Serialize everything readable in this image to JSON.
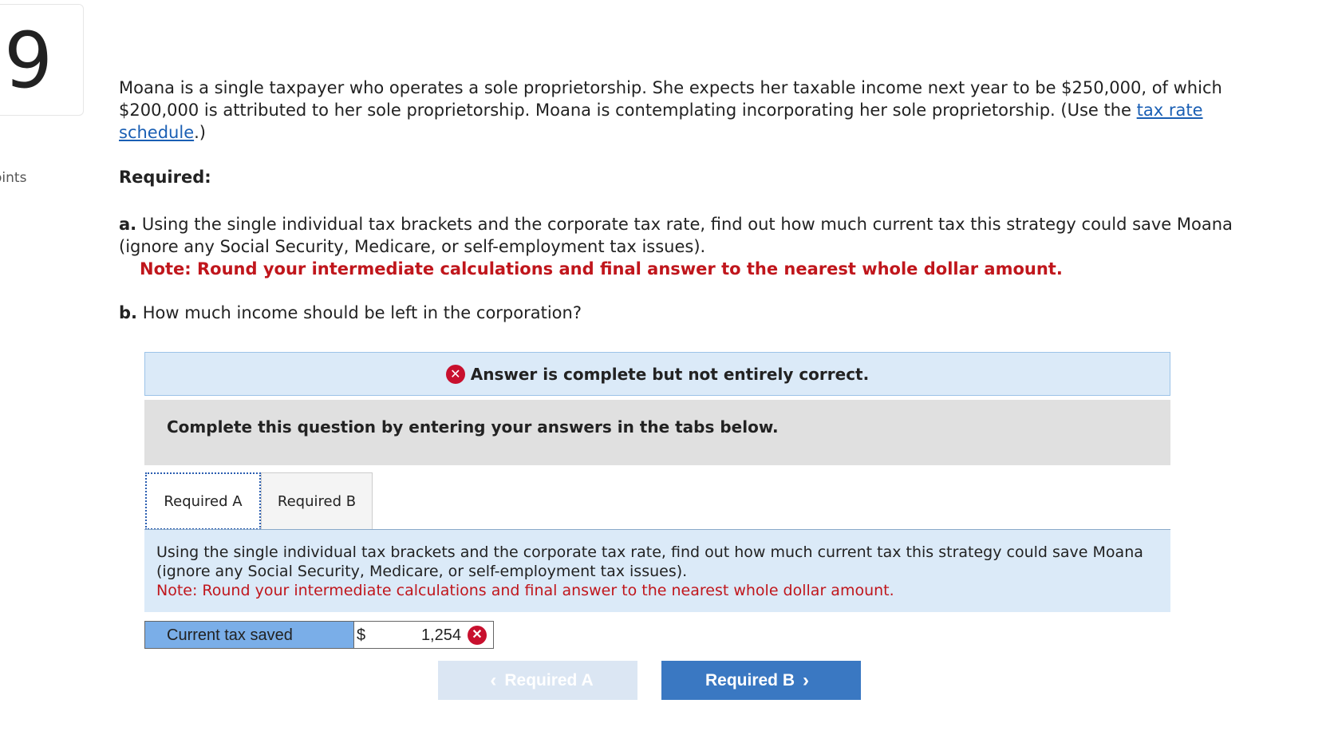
{
  "question": {
    "number": "9",
    "points_label": "oints",
    "intro_text": "Moana is a single taxpayer who operates a sole proprietorship. She expects her taxable income next year to be $250,000, of which $200,000 is attributed to her sole proprietorship. Moana is contemplating incorporating her sole proprietorship. (Use the ",
    "intro_link": "tax rate schedule",
    "intro_end": ".)",
    "required_heading": "Required:",
    "part_a_label": "a.",
    "part_a_text": "Using the single individual tax brackets and the corporate tax rate, find out how much current tax this strategy could save Moana (ignore any Social Security, Medicare, or self-employment tax issues).",
    "part_a_note": "Note: Round your intermediate calculations and final answer to the nearest whole dollar amount.",
    "part_b_label": "b.",
    "part_b_text": "How much income should be left in the corporation?"
  },
  "banner": {
    "icon": "x-circle-icon",
    "icon_glyph": "✕",
    "text": "Answer is complete but not entirely correct."
  },
  "complete_bar": "Complete this question by entering your answers in the tabs below.",
  "tabs": [
    {
      "label": "Required A",
      "active": true
    },
    {
      "label": "Required B",
      "active": false
    }
  ],
  "instruction": {
    "text": "Using the single individual tax brackets and the corporate tax rate, find out how much current tax this strategy could save Moana (ignore any Social Security, Medicare, or self-employment tax issues).",
    "note": "Note: Round your intermediate calculations and final answer to the nearest whole dollar amount."
  },
  "answer": {
    "label": "Current tax saved",
    "currency": "$",
    "value": "1,254",
    "status_icon": "x-circle-icon",
    "status_glyph": "✕"
  },
  "nav": {
    "prev_label": "Required A",
    "next_label": "Required B",
    "prev_chevron": "‹",
    "next_chevron": "›"
  },
  "colors": {
    "error_red": "#c8102e",
    "link_blue": "#1a5fb4",
    "banner_bg": "#dbeaf8",
    "label_bg": "#7aaee8",
    "next_btn": "#3a78c2",
    "prev_btn_disabled": "#dbe6f3"
  }
}
